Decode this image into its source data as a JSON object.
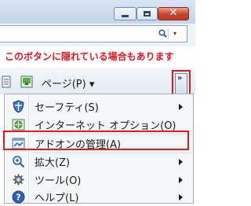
{
  "window": {
    "minimize_icon": "minimize-icon",
    "maximize_icon": "maximize-icon",
    "close_label": "✕"
  },
  "address_bar": {
    "search_icon": "search-icon",
    "dropdown_glyph": "▾"
  },
  "annotation": {
    "text": "このボタンに隠れている場合もあります",
    "color": "#e4151d"
  },
  "command_bar": {
    "page_label": "ページ(P) ▾",
    "chevron_label": "»",
    "icons": [
      "print-icon",
      "feed-icon"
    ]
  },
  "menu": {
    "items": [
      {
        "label": "セーフティ(S)",
        "icon": "shield-icon",
        "submenu": true
      },
      {
        "label": "インターネット オプション(O)",
        "icon": "internet-options-icon",
        "submenu": false
      },
      {
        "label": "アドオンの管理(A)",
        "icon": "addons-icon",
        "submenu": false
      },
      {
        "label": "拡大(Z)",
        "icon": "zoom-icon",
        "submenu": true
      },
      {
        "label": "ツール(O)",
        "icon": "tools-icon",
        "submenu": true
      },
      {
        "label": "ヘルプ(L)",
        "icon": "help-icon",
        "submenu": true
      }
    ]
  },
  "colors": {
    "annotation_red": "#e01a1f",
    "title_bar": "#c3d6ec",
    "menu_background": "#f5f6f8"
  }
}
